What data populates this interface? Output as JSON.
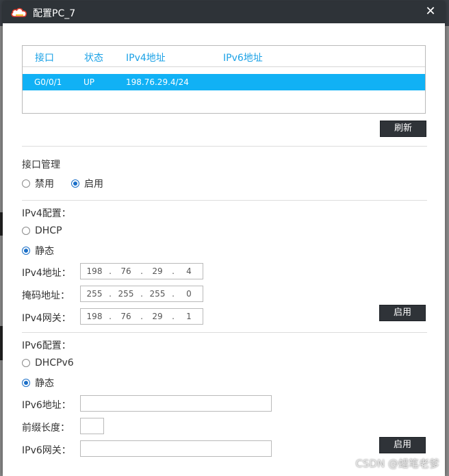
{
  "window": {
    "title": "配置PC_7",
    "close_symbol": "✕",
    "background_hint": "HCL"
  },
  "interfaces": {
    "headers": [
      "接口",
      "状态",
      "IPv4地址",
      "IPv6地址"
    ],
    "rows": [
      {
        "name": "G0/0/1",
        "status": "UP",
        "ipv4": "198.76.29.4/24",
        "ipv6": ""
      }
    ],
    "refresh_label": "刷新"
  },
  "iface_mgmt": {
    "title": "接口管理",
    "options": [
      "禁用",
      "启用"
    ],
    "selected": "启用"
  },
  "ipv4": {
    "title": "IPv4配置：",
    "mode_options": [
      "DHCP",
      "静态"
    ],
    "selected": "静态",
    "address_label": "IPv4地址：",
    "address": [
      "198",
      "76",
      "29",
      "4"
    ],
    "mask_label": "掩码地址：",
    "mask": [
      "255",
      "255",
      "255",
      "0"
    ],
    "gateway_label": "IPv4网关：",
    "gateway": [
      "198",
      "76",
      "29",
      "1"
    ],
    "apply_label": "启用"
  },
  "ipv6": {
    "title": "IPv6配置：",
    "mode_options": [
      "DHCPv6",
      "静态"
    ],
    "selected": "静态",
    "address_label": "IPv6地址：",
    "address": "",
    "prefix_label": "前缀长度：",
    "prefix": "",
    "gateway_label": "IPv6网关：",
    "gateway": "",
    "apply_label": "启用"
  },
  "watermark": "CSDN @蜡笔老爹",
  "colors": {
    "titlebar": "#2e3338",
    "accent_header": "#1aa1e6",
    "selected_row": "#11b1f5",
    "button": "#2f3338",
    "radio_checked": "#1b6fc7"
  }
}
